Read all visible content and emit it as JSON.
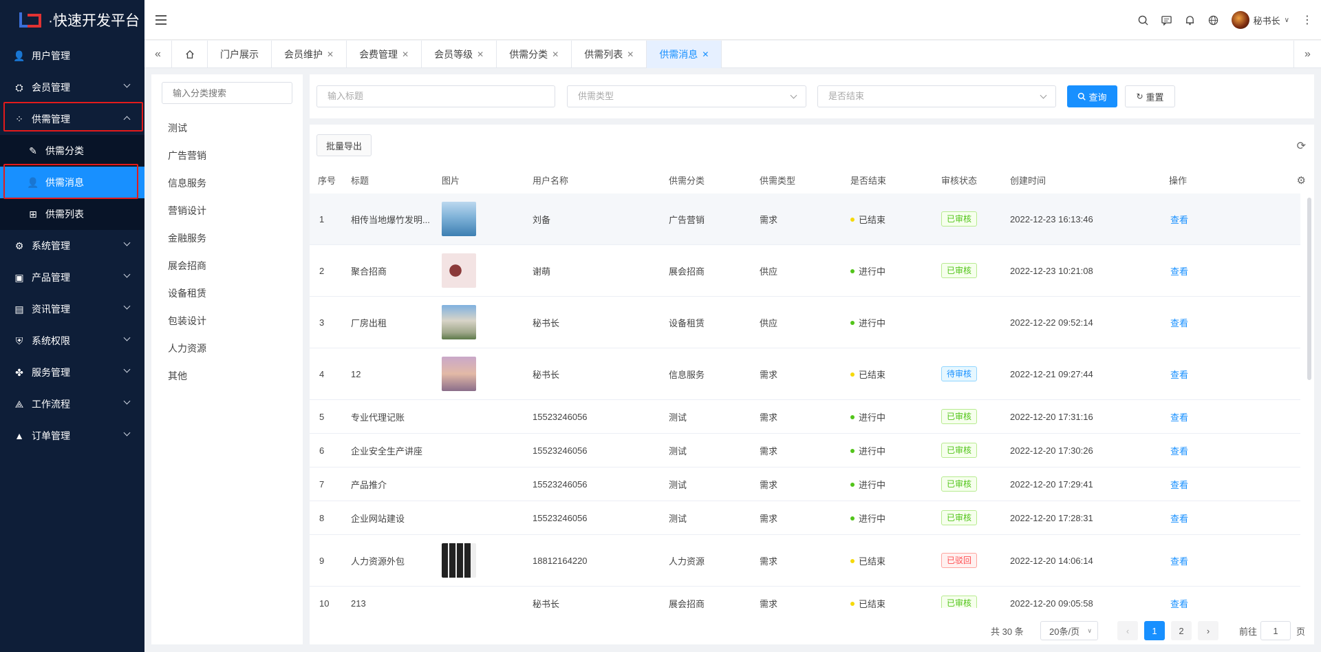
{
  "app": {
    "title": "·快速开发平台"
  },
  "sidebar": {
    "items": [
      {
        "label": "用户管理",
        "icon": "user-icon"
      },
      {
        "label": "会员管理",
        "icon": "members-icon",
        "expandable": true
      },
      {
        "label": "供需管理",
        "icon": "grid-icon",
        "expandable": true,
        "expanded": true
      },
      {
        "label": "系统管理",
        "icon": "gear-icon",
        "expandable": true
      },
      {
        "label": "产品管理",
        "icon": "product-icon",
        "expandable": true
      },
      {
        "label": "资讯管理",
        "icon": "document-icon",
        "expandable": true
      },
      {
        "label": "系统权限",
        "icon": "shield-icon",
        "expandable": true
      },
      {
        "label": "服务管理",
        "icon": "service-icon",
        "expandable": true
      },
      {
        "label": "工作流程",
        "icon": "flow-icon",
        "expandable": true
      },
      {
        "label": "订单管理",
        "icon": "triangle-icon",
        "expandable": true
      }
    ],
    "sub_items": [
      {
        "label": "供需分类",
        "icon": "pen-icon"
      },
      {
        "label": "供需消息",
        "icon": "user-icon",
        "active": true
      },
      {
        "label": "供需列表",
        "icon": "tree-icon"
      }
    ]
  },
  "header": {
    "username": "秘书长"
  },
  "tabs": [
    {
      "label": "门户展示",
      "closable": false
    },
    {
      "label": "会员维护",
      "closable": true
    },
    {
      "label": "会费管理",
      "closable": true
    },
    {
      "label": "会员等级",
      "closable": true
    },
    {
      "label": "供需分类",
      "closable": true
    },
    {
      "label": "供需列表",
      "closable": true
    },
    {
      "label": "供需消息",
      "closable": true,
      "active": true
    }
  ],
  "category_panel": {
    "search_placeholder": "输入分类搜索",
    "items": [
      "测试",
      "广告营销",
      "信息服务",
      "营销设计",
      "金融服务",
      "展会招商",
      "设备租赁",
      "包装设计",
      "人力资源",
      "其他"
    ]
  },
  "filters": {
    "title_placeholder": "输入标题",
    "type_placeholder": "供需类型",
    "finished_placeholder": "是否结束",
    "search_label": "查询",
    "reset_label": "重置"
  },
  "toolbar": {
    "export_label": "批量导出"
  },
  "table": {
    "columns": [
      "序号",
      "标题",
      "图片",
      "用户名称",
      "供需分类",
      "供需类型",
      "是否结束",
      "审核状态",
      "创建时间",
      "操作"
    ],
    "rows": [
      {
        "no": "1",
        "title": "相传当地爆竹发明...",
        "image": "lake",
        "user": "刘备",
        "category": "广告营销",
        "type": "需求",
        "finished": "已结束",
        "audit": "已审核",
        "created": "2022-12-23 16:13:46",
        "action": "查看"
      },
      {
        "no": "2",
        "title": "聚合招商",
        "image": "poster",
        "user": "谢萌",
        "category": "展会招商",
        "type": "供应",
        "finished": "进行中",
        "audit": "已审核",
        "created": "2022-12-23 10:21:08",
        "action": "查看"
      },
      {
        "no": "3",
        "title": "厂房出租",
        "image": "building",
        "user": "秘书长",
        "category": "设备租赁",
        "type": "供应",
        "finished": "进行中",
        "audit": "",
        "created": "2022-12-22 09:52:14",
        "action": "查看"
      },
      {
        "no": "4",
        "title": "12",
        "image": "sunset",
        "user": "秘书长",
        "category": "信息服务",
        "type": "需求",
        "finished": "已结束",
        "audit": "待审核",
        "created": "2022-12-21 09:27:44",
        "action": "查看"
      },
      {
        "no": "5",
        "title": "专业代理记账",
        "image": "",
        "user": "15523246056",
        "category": "测试",
        "type": "需求",
        "finished": "进行中",
        "audit": "已审核",
        "created": "2022-12-20 17:31:16",
        "action": "查看"
      },
      {
        "no": "6",
        "title": "企业安全生产讲座",
        "image": "",
        "user": "15523246056",
        "category": "测试",
        "type": "需求",
        "finished": "进行中",
        "audit": "已审核",
        "created": "2022-12-20 17:30:26",
        "action": "查看"
      },
      {
        "no": "7",
        "title": "产品推介",
        "image": "",
        "user": "15523246056",
        "category": "测试",
        "type": "需求",
        "finished": "进行中",
        "audit": "已审核",
        "created": "2022-12-20 17:29:41",
        "action": "查看"
      },
      {
        "no": "8",
        "title": "企业网站建设",
        "image": "",
        "user": "15523246056",
        "category": "测试",
        "type": "需求",
        "finished": "进行中",
        "audit": "已审核",
        "created": "2022-12-20 17:28:31",
        "action": "查看"
      },
      {
        "no": "9",
        "title": "人力资源外包",
        "image": "people",
        "user": "18812164220",
        "category": "人力资源",
        "type": "需求",
        "finished": "已结束",
        "audit": "已驳回",
        "created": "2022-12-20 14:06:14",
        "action": "查看"
      },
      {
        "no": "10",
        "title": "213",
        "image": "",
        "user": "秘书长",
        "category": "展会招商",
        "type": "需求",
        "finished": "已结束",
        "audit": "已审核",
        "created": "2022-12-20 09:05:58",
        "action": "查看"
      }
    ]
  },
  "pagination": {
    "total_text": "共 30 条",
    "page_size": "20条/页",
    "pages": [
      "1",
      "2"
    ],
    "current": "1",
    "goto_prefix": "前往",
    "goto_value": "1",
    "goto_suffix": "页"
  },
  "colors": {
    "accent": "#1890ff",
    "sidebar": "#0e1e38",
    "finished_dot": "#f5d90a",
    "ongoing_dot": "#52c41a",
    "approved": "#52c41a",
    "pending": "#1890ff",
    "rejected": "#ff4d4f"
  }
}
